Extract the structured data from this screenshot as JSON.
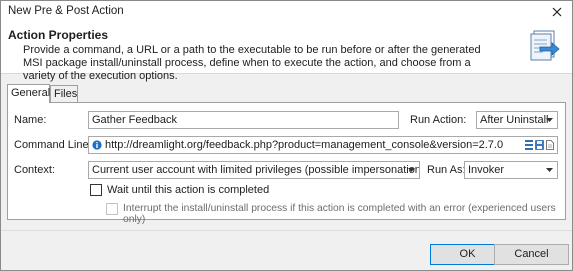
{
  "window": {
    "title": "New Pre & Post Action"
  },
  "header": {
    "title": "Action Properties",
    "description": "Provide a command, a URL or a path to the executable to be run before or after the generated MSI package install/uninstall process, define when to execute the action, and choose from a variety of the execution options."
  },
  "tabs": [
    {
      "label": "General"
    },
    {
      "label": "Files"
    }
  ],
  "form": {
    "name_label": "Name:",
    "name_value": "Gather Feedback",
    "run_action_label": "Run Action:",
    "run_action_value": "After Uninstall",
    "command_label": "Command Line:",
    "command_value": "http://dreamlight.org/feedback.php?product=management_console&version=2.7.0",
    "context_label": "Context:",
    "context_value": "Current user account with limited privileges (possible impersonation)",
    "run_as_label": "Run As:",
    "run_as_value": "Invoker",
    "wait_label": "Wait until this action is completed",
    "interrupt_label": "Interrupt the install/uninstall process if this action is completed with an error (experienced users only)"
  },
  "buttons": {
    "ok": "OK",
    "cancel": "Cancel"
  },
  "colors": {
    "accent": "#0078d7",
    "info_icon": "#1f6fc5"
  }
}
